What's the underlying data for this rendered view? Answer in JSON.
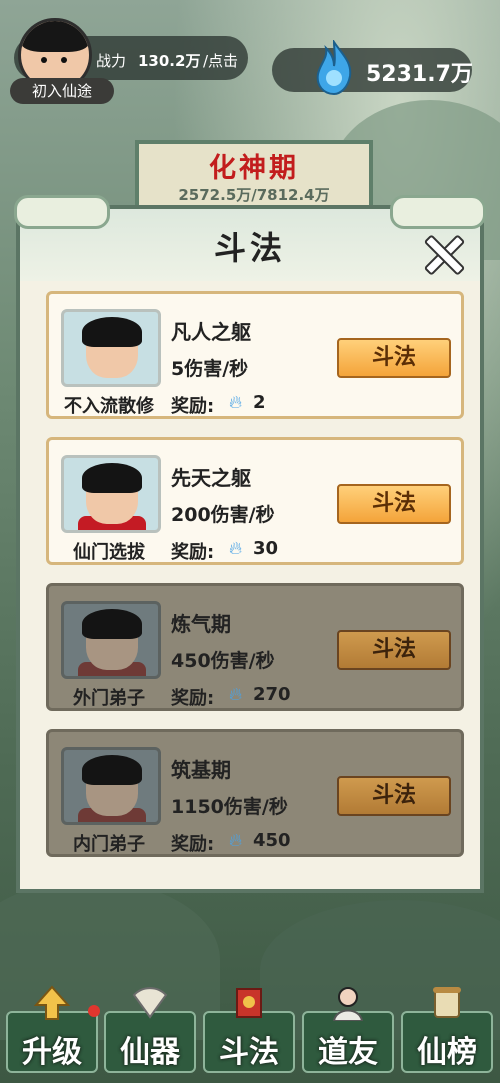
{
  "player": {
    "power_label": "战力",
    "power_value": "130.2万",
    "tap_label": "/点击",
    "rank": "初入仙途"
  },
  "currency": {
    "value": "5231.7万",
    "icon": "blue-spirit-flame-icon"
  },
  "realm_plaque": {
    "title": "化神期",
    "progress": "2572.5万/7812.4万"
  },
  "dialog": {
    "title": "斗法",
    "opponents": [
      {
        "realm": "凡人之躯",
        "dps": "5伤害/秒",
        "title": "不入流散修",
        "reward_label": "奖励:",
        "reward": "2",
        "button": "斗法",
        "locked": false
      },
      {
        "realm": "先天之躯",
        "dps": "200伤害/秒",
        "title": "仙门选拔",
        "reward_label": "奖励:",
        "reward": "30",
        "button": "斗法",
        "locked": false
      },
      {
        "realm": "炼气期",
        "dps": "450伤害/秒",
        "title": "外门弟子",
        "reward_label": "奖励:",
        "reward": "270",
        "button": "斗法",
        "locked": true
      },
      {
        "realm": "筑基期",
        "dps": "1150伤害/秒",
        "title": "内门弟子",
        "reward_label": "奖励:",
        "reward": "450",
        "button": "斗法",
        "locked": true
      }
    ]
  },
  "nav": [
    {
      "label": "升级",
      "icon": "upgrade-arrow-icon",
      "badge": true
    },
    {
      "label": "仙器",
      "icon": "fan-icon",
      "badge": false
    },
    {
      "label": "斗法",
      "icon": "banner-icon",
      "badge": false
    },
    {
      "label": "道友",
      "icon": "companion-icon",
      "badge": false
    },
    {
      "label": "仙榜",
      "icon": "scroll-icon",
      "badge": false
    }
  ]
}
